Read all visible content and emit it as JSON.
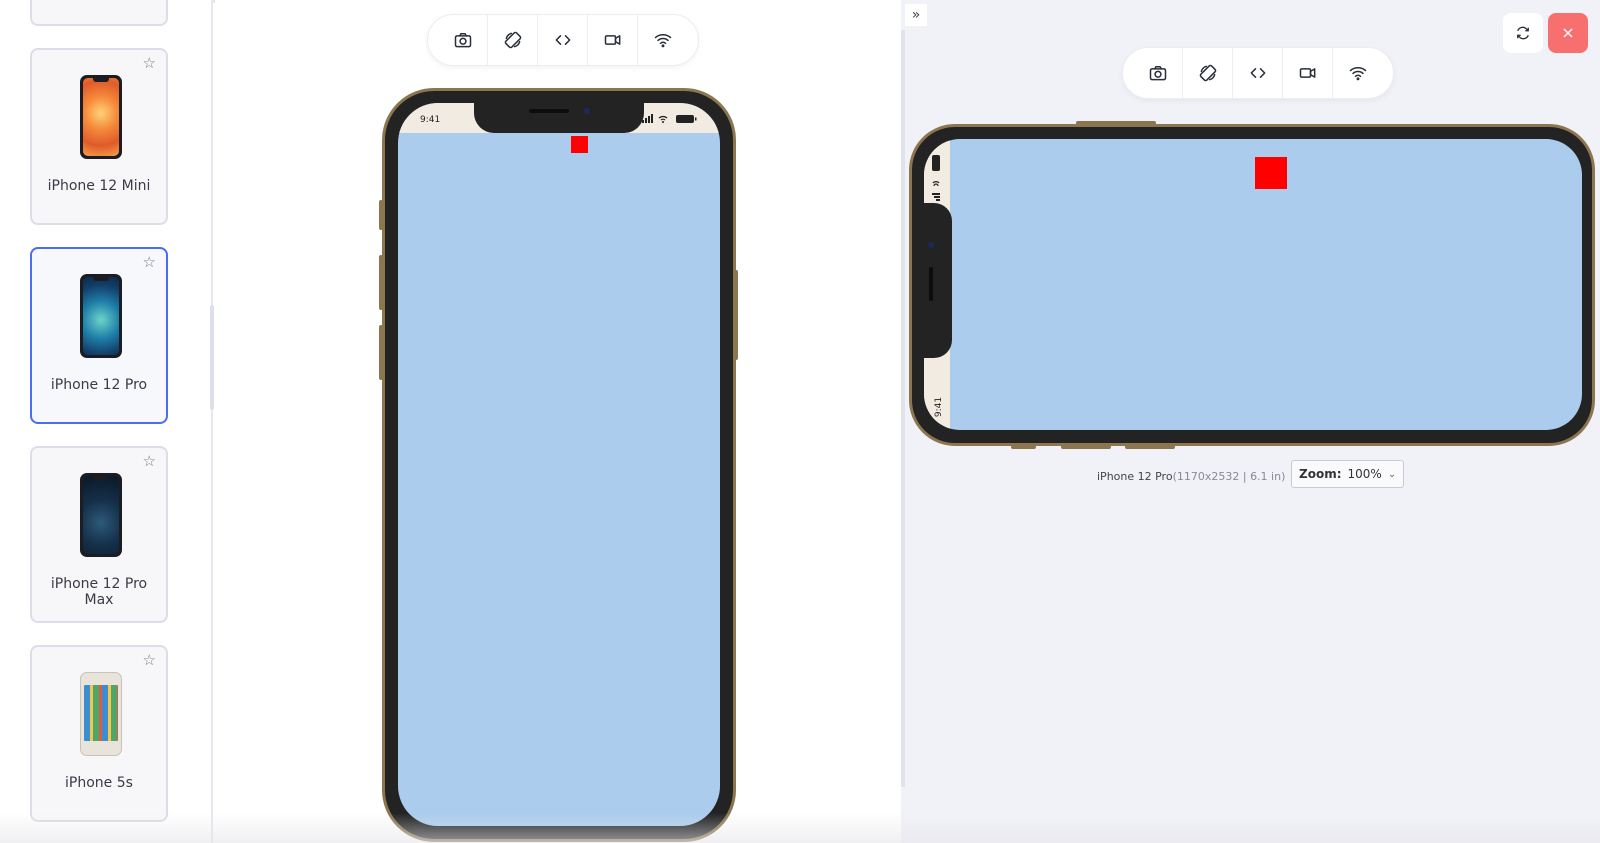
{
  "sidebar": {
    "devices": [
      {
        "label": "iPhone 12 Mini",
        "favorite": false,
        "selected": false,
        "screen_color": "#f08a3e"
      },
      {
        "label": "iPhone 12 Pro",
        "favorite": false,
        "selected": true,
        "screen_color": "#1f6f9a"
      },
      {
        "label": "iPhone 12 Pro Max",
        "favorite": false,
        "selected": false,
        "screen_color": "#13263a"
      },
      {
        "label": "iPhone 5s",
        "favorite": false,
        "selected": false,
        "screen_color": "#3a7a4a"
      }
    ],
    "star_glyph": "☆"
  },
  "toolbar": {
    "items": [
      {
        "icon": "camera-icon"
      },
      {
        "icon": "rotate-icon"
      },
      {
        "icon": "code-icon"
      },
      {
        "icon": "video-icon"
      },
      {
        "icon": "wifi-icon"
      }
    ]
  },
  "portrait_phone": {
    "time": "9:41",
    "screen_color": "#abcced",
    "square_color": "#ff0000"
  },
  "right_panel": {
    "collapse_glyph": "»",
    "landscape_phone": {
      "time": "9:41",
      "screen_color": "#abcced",
      "square_color": "#ff0000"
    },
    "device_name": "iPhone 12 Pro",
    "device_spec": "(1170x2532 | 6.1 in)",
    "zoom_label": "Zoom:",
    "zoom_value": "100%",
    "close_color": "#f86f6f"
  },
  "colors": {
    "accent": "#4a6cf7",
    "frame_gold": "#8c7650"
  }
}
